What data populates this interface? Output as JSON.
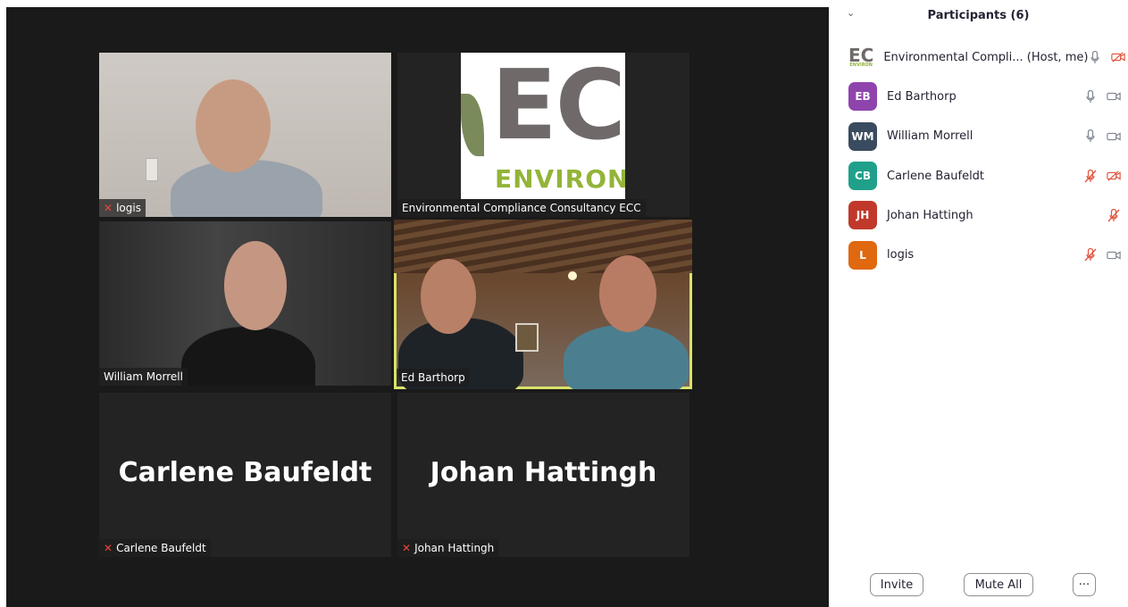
{
  "gallery": {
    "tiles": [
      {
        "name": "logis",
        "muted": true
      },
      {
        "name": "Environmental Compliance Consultancy ECC",
        "muted": false,
        "logo_text": "EC",
        "logo_sub": "ENVIRON"
      },
      {
        "name": "William Morrell",
        "muted": false
      },
      {
        "name": "Ed Barthorp",
        "muted": false,
        "active": true
      },
      {
        "name": "Carlene Baufeldt",
        "muted": true,
        "display_name": "Carlene Baufeldt"
      },
      {
        "name": "Johan Hattingh",
        "muted": true,
        "display_name": "Johan Hattingh"
      }
    ]
  },
  "panel": {
    "title": "Participants (6)",
    "participants": [
      {
        "initials": "EC",
        "name": "Environmental Compli... (Host, me)",
        "color": "",
        "mic": "on",
        "video": "off"
      },
      {
        "initials": "EB",
        "name": "Ed Barthorp",
        "color": "#8f44ad",
        "mic": "on",
        "video": "on"
      },
      {
        "initials": "WM",
        "name": "William Morrell",
        "color": "#394b5e",
        "mic": "on",
        "video": "on"
      },
      {
        "initials": "CB",
        "name": "Carlene Baufeldt",
        "color": "#20a08a",
        "mic": "off",
        "video": "off"
      },
      {
        "initials": "JH",
        "name": "Johan Hattingh",
        "color": "#c0392b",
        "mic": "off",
        "video": "none"
      },
      {
        "initials": "L",
        "name": "logis",
        "color": "#e0680f",
        "mic": "off",
        "video": "on"
      }
    ],
    "buttons": {
      "invite": "Invite",
      "mute_all": "Mute All",
      "more": "···"
    }
  },
  "icons": {
    "mic_muted": "🎤",
    "collapse": "⌄"
  },
  "colors": {
    "muted_red": "#e0533d",
    "active_speaker": "#d9e36b",
    "gallery_bg": "#1a1a1a"
  }
}
